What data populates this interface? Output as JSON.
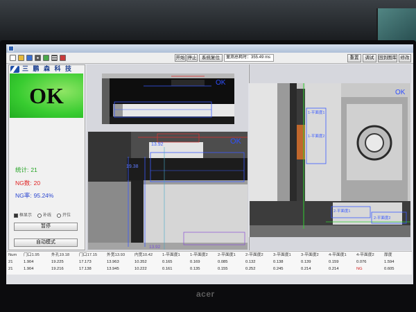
{
  "toolbar": {
    "icons": [
      "new-file-icon",
      "open-folder-icon",
      "save-icon",
      "camera-icon",
      "image-icon",
      "list-icon",
      "exit-icon"
    ],
    "start_label": "开始",
    "stop_label": "停止",
    "reset_label": "系统复位",
    "cycle_time": "量测总耗时：355.49 ms",
    "right_buttons": [
      "重置",
      "调试",
      "回到图库",
      "修改"
    ]
  },
  "brand": {
    "logo_text": "三 鹏 森 科 技"
  },
  "result": {
    "status": "OK"
  },
  "stats": {
    "total": {
      "label": "统计:",
      "value": "21"
    },
    "ng_count": {
      "label": "NG数:",
      "value": "20"
    },
    "ng_rate": {
      "label": "NG率:",
      "value": "95.24%"
    }
  },
  "options": [
    {
      "label": "框显示",
      "checked": true
    },
    {
      "label": "补线",
      "checked": false
    },
    {
      "label": "开位",
      "checked": false
    }
  ],
  "controls": {
    "pause_label": "暂停",
    "mode_label": "自动模式"
  },
  "views": {
    "top": {
      "status": "OK"
    },
    "main": {
      "status": "OK",
      "labels": [
        "13.92",
        "19.38",
        "13.92"
      ]
    },
    "side": {
      "status": "OK",
      "labels": [
        "1-平面度1",
        "1-平面度2",
        "2-平面度1",
        "2-平面度2"
      ]
    }
  },
  "table": {
    "headers": [
      "Num",
      "门口1.95",
      "外孔19.18",
      "门口17.15",
      "外宽13.93",
      "内宽10.42",
      "1-平面度1",
      "1-平面度2",
      "2-平面度1",
      "2-平面度2",
      "3-平面度1",
      "3-平面度2",
      "4-平面度1",
      "4-平面度2",
      "厚度"
    ],
    "rows": [
      [
        "21",
        "1.904",
        "19.225",
        "17.173",
        "13.963",
        "10.352",
        "0.165",
        "0.169",
        "0.085",
        "0.132",
        "0.138",
        "0.139",
        "0.159",
        "0.076",
        "1.594"
      ],
      [
        "21",
        "1.904",
        "19.216",
        "17.138",
        "13.945",
        "10.222",
        "0.161",
        "0.135",
        "0.155",
        "0.252",
        "0.245",
        "0.214",
        "0.214",
        "NG",
        "0.605"
      ]
    ]
  },
  "monitor": {
    "brand": "acer"
  },
  "colors": {
    "result_ok": "#38cc30",
    "stat_total": "#22a322",
    "stat_ng": "#e02222",
    "stat_rate": "#2a46d0",
    "annotation_blue": "#3b5bff",
    "trace_green": "#2fd12f",
    "ng_text": "#d42020"
  }
}
